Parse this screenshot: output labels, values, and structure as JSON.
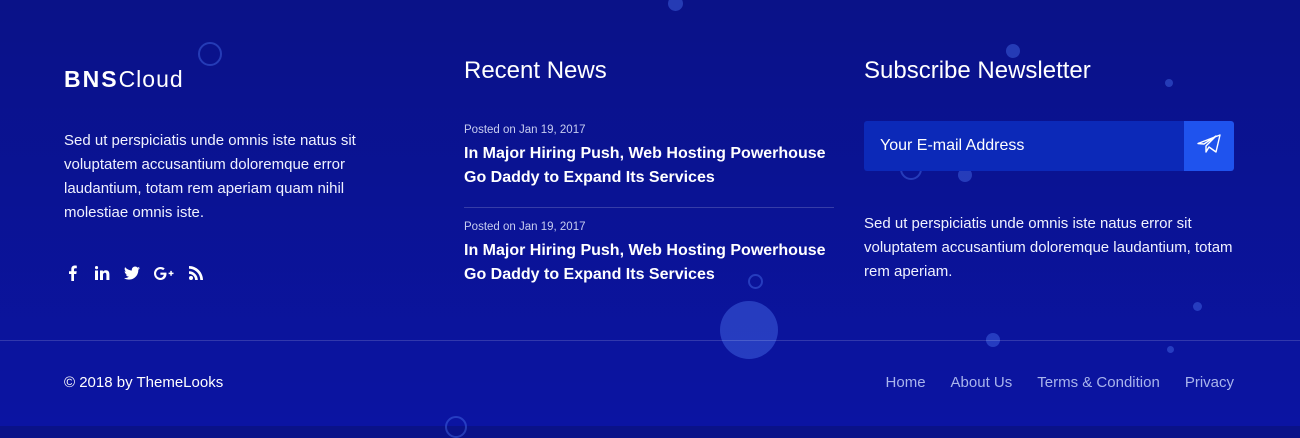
{
  "brand": {
    "logo_bold": "BNS",
    "logo_light": "Cloud"
  },
  "about": {
    "text": "Sed ut perspiciatis unde omnis iste natus sit voluptatem accusantium doloremque error laudantium, totam rem aperiam quam nihil molestiae omnis iste."
  },
  "social": {
    "icons": [
      "facebook-icon",
      "linkedin-icon",
      "twitter-icon",
      "google-plus-icon",
      "rss-icon"
    ]
  },
  "news": {
    "heading": "Recent News",
    "items": [
      {
        "date": "Posted on Jan 19, 2017",
        "title": "In Major Hiring Push, Web Hosting Powerhouse Go Daddy to Expand Its Services"
      },
      {
        "date": "Posted on Jan 19, 2017",
        "title": "In Major Hiring Push, Web Hosting Powerhouse Go Daddy to Expand Its Services"
      }
    ]
  },
  "newsletter": {
    "heading": "Subscribe Newsletter",
    "placeholder": "Your E-mail Address",
    "send_icon": "paper-plane-icon",
    "text": "Sed ut perspiciatis unde omnis iste natus error sit voluptatem accusantium doloremque laudantium, totam rem aperiam."
  },
  "footer": {
    "copyright": "© 2018 by ThemeLooks",
    "links": [
      "Home",
      "About Us",
      "Terms & Condition",
      "Privacy"
    ]
  },
  "colors": {
    "background_top": "#0a1288",
    "background_bottom": "#0b14a2",
    "input_bg": "#0c29b8",
    "send_button": "#1f53ee",
    "link": "#a9b4ec"
  }
}
